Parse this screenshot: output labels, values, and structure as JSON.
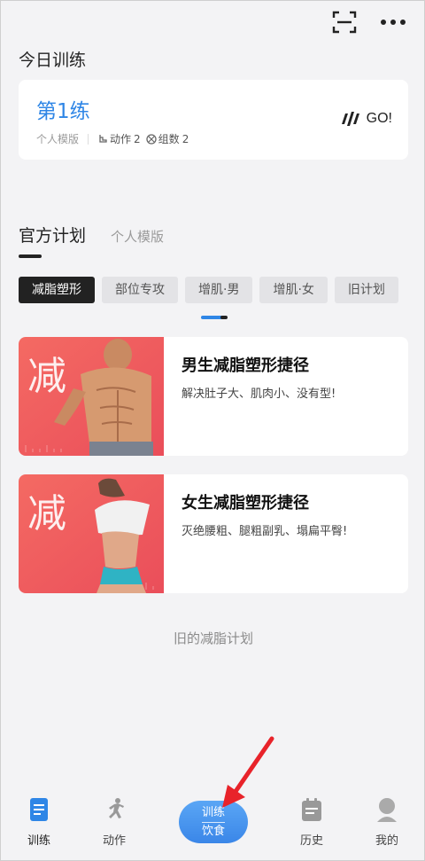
{
  "header": {
    "scan_icon": "scan-icon",
    "more_icon": "more-icon"
  },
  "today": {
    "section_title": "今日训练",
    "card": {
      "name": "第1练",
      "template_label": "个人模版",
      "moves_label": "动作",
      "moves_count": "2",
      "sets_label": "组数",
      "sets_count": "2",
      "go_label": "GO!"
    }
  },
  "plans": {
    "tabs": [
      {
        "label": "官方计划",
        "active": true
      },
      {
        "label": "个人模版",
        "active": false
      }
    ],
    "chips": [
      {
        "label": "减脂塑形",
        "active": true
      },
      {
        "label": "部位专攻",
        "active": false
      },
      {
        "label": "增肌·男",
        "active": false
      },
      {
        "label": "增肌·女",
        "active": false
      },
      {
        "label": "旧计划",
        "active": false
      }
    ],
    "cards": [
      {
        "thumb_char": "减",
        "title": "男生减脂塑形捷径",
        "desc": "解决肚子大、肌肉小、没有型!"
      },
      {
        "thumb_char": "减",
        "title": "女生减脂塑形捷径",
        "desc": "灭绝腰粗、腿粗副乳、塌扁平臀!"
      }
    ],
    "old_plans_link": "旧的减脂计划"
  },
  "bottom_nav": {
    "items": [
      {
        "label": "训练",
        "icon": "doc-icon",
        "active": true
      },
      {
        "label": "动作",
        "icon": "runner-icon",
        "active": false
      },
      {
        "label": "历史",
        "icon": "calendar-icon",
        "active": false
      },
      {
        "label": "我的",
        "icon": "user-icon",
        "active": false
      }
    ],
    "center": {
      "top": "训练",
      "bottom": "饮食"
    }
  },
  "colors": {
    "accent": "#2f86e6",
    "thumb_bg": "#f0625f",
    "arrow": "#e8232a"
  }
}
